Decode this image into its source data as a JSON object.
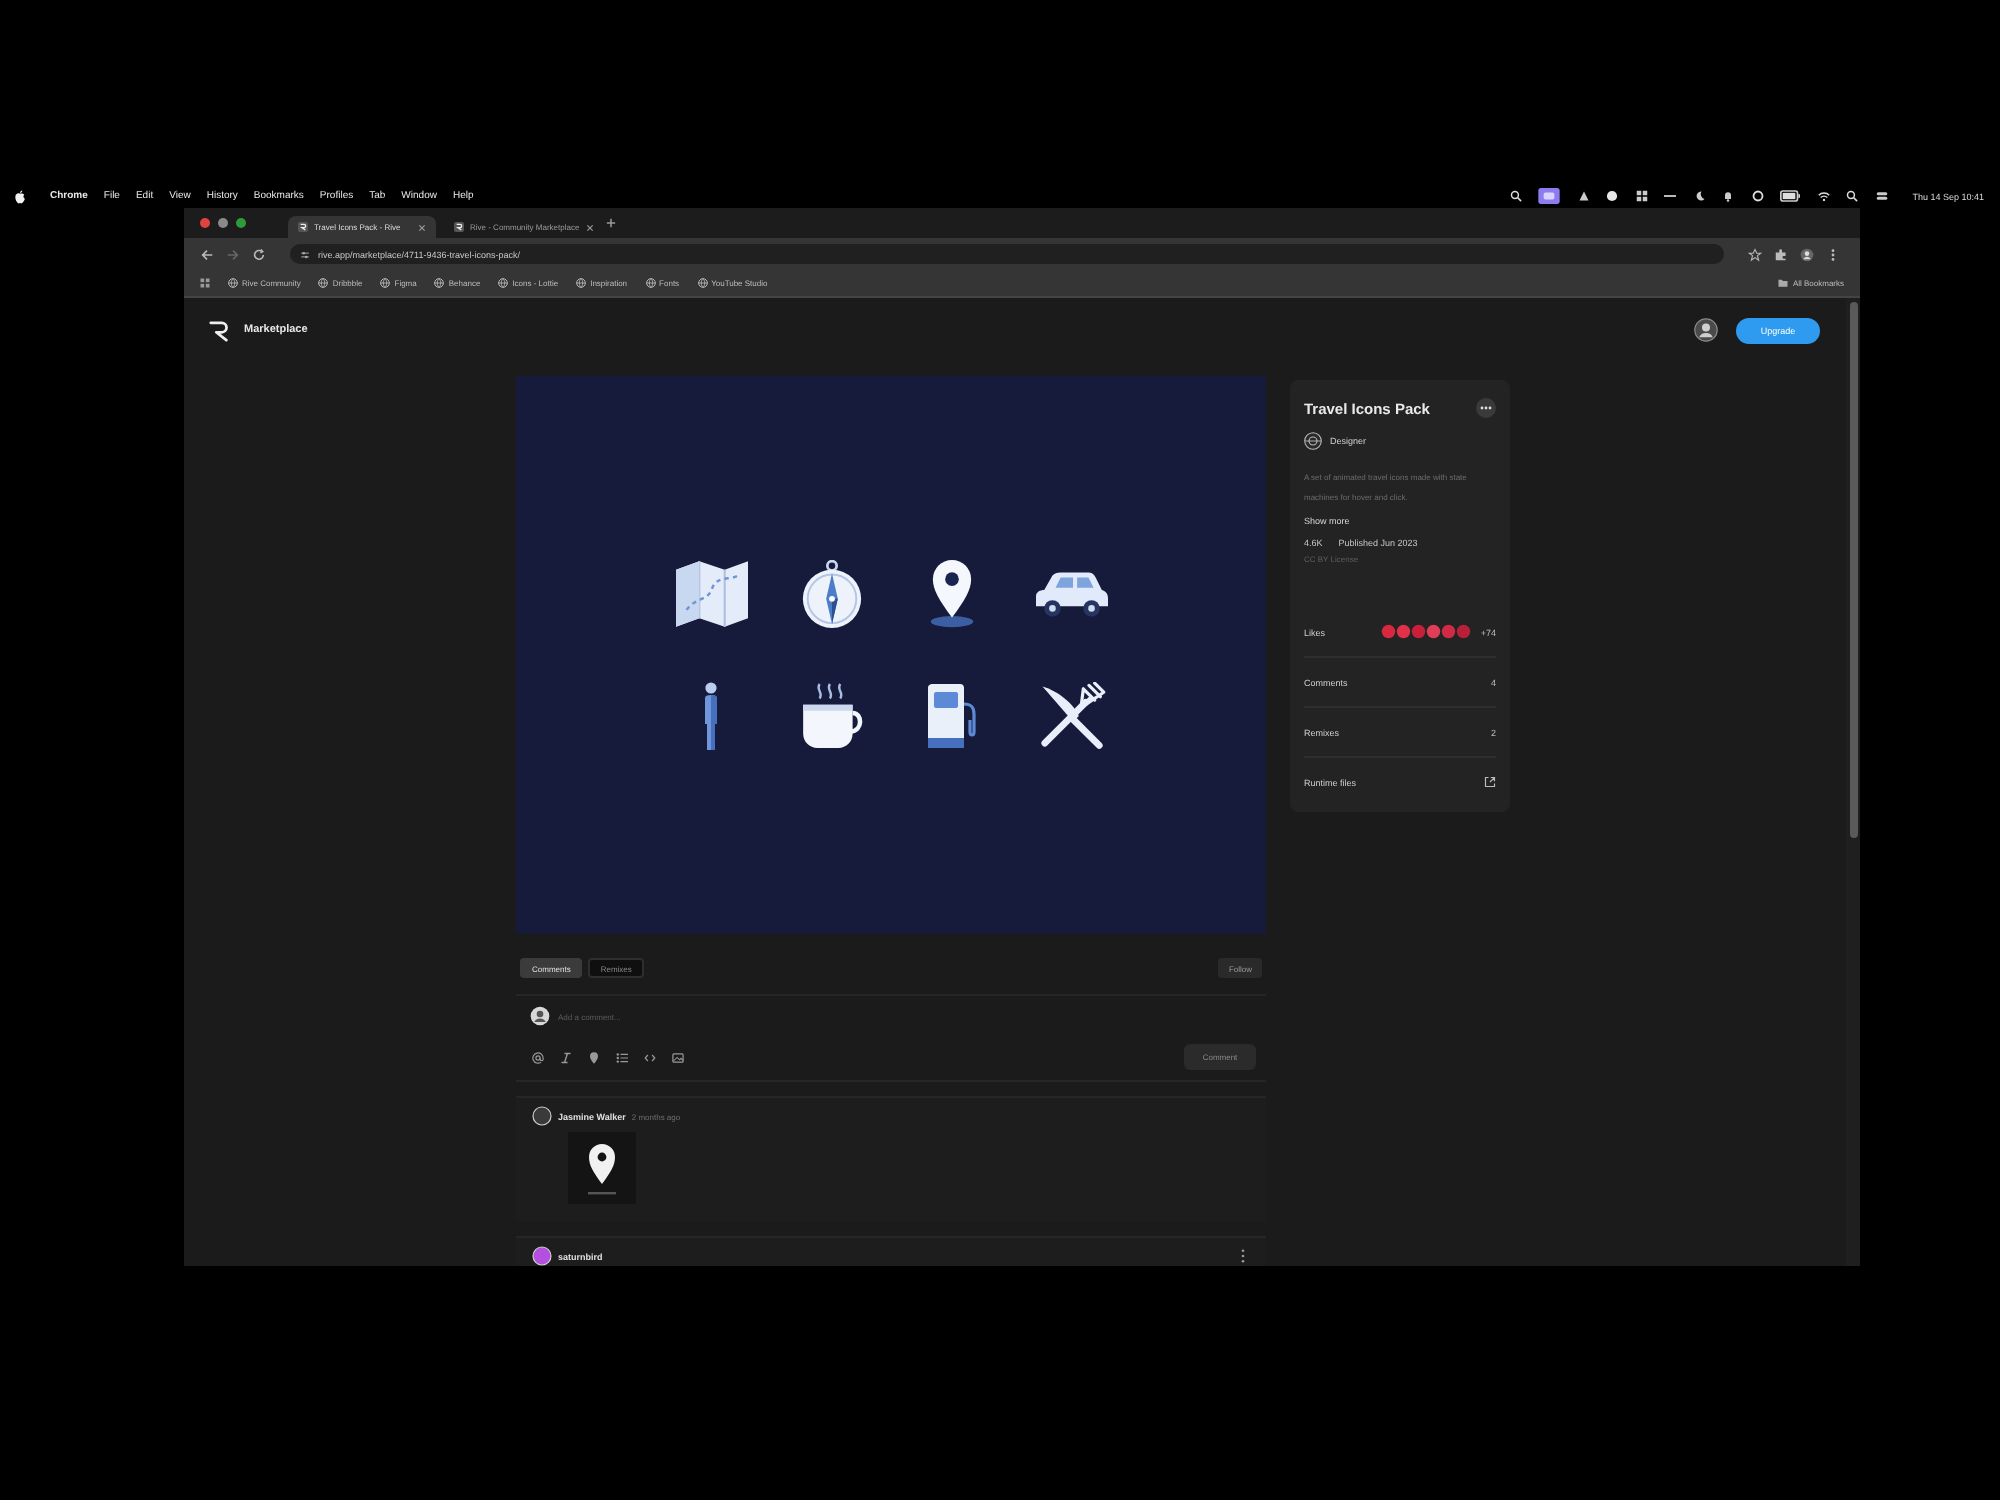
{
  "menu_bar": {
    "items": [
      "Chrome",
      "File",
      "Edit",
      "View",
      "History",
      "Bookmarks",
      "Profiles",
      "Tab",
      "Window",
      "Help"
    ],
    "clock": "Thu 14 Sep 10:41"
  },
  "browser": {
    "tabs": [
      {
        "title": "Travel Icons Pack - Rive",
        "selected": true
      },
      {
        "title": "Rive - Community Marketplace",
        "selected": false
      }
    ],
    "address": "rive.app/marketplace/4711-9436-travel-icons-pack/",
    "bookmarks": [
      "Rive Community",
      "Dribbble",
      "Figma",
      "Behance",
      "Icons - Lottie",
      "Inspiration",
      "Fonts",
      "YouTube Studio"
    ],
    "all_bookmarks": "All Bookmarks"
  },
  "site_header": {
    "brand": "Marketplace",
    "button": "Upgrade"
  },
  "details": {
    "title": "Travel Icons Pack",
    "author": "Designer",
    "description": "A set of animated travel icons made with state machines for hover and click.",
    "show_more": "Show more",
    "downloads": "4.6K",
    "published": "Published Jun 2023",
    "license": "CC BY License",
    "stats": [
      {
        "kind": "avatars",
        "label": "Likes",
        "value": "+74"
      },
      {
        "kind": "count",
        "label": "Comments",
        "value": "4"
      },
      {
        "kind": "count",
        "label": "Remixes",
        "value": "2"
      },
      {
        "kind": "link",
        "label": "Runtime files"
      }
    ]
  },
  "discussion": {
    "tabs": [
      {
        "label": "Comments",
        "selected": true
      },
      {
        "label": "Remixes",
        "selected": false
      }
    ],
    "follow": "Follow",
    "composer": {
      "placeholder": "Add a comment...",
      "submit": "Comment"
    },
    "comments": [
      {
        "author": "Jasmine Walker",
        "time": "2 months ago",
        "color": "#3a3a3a",
        "attachment": true
      },
      {
        "author": "saturnbird",
        "color": "#b44fe0"
      }
    ]
  }
}
